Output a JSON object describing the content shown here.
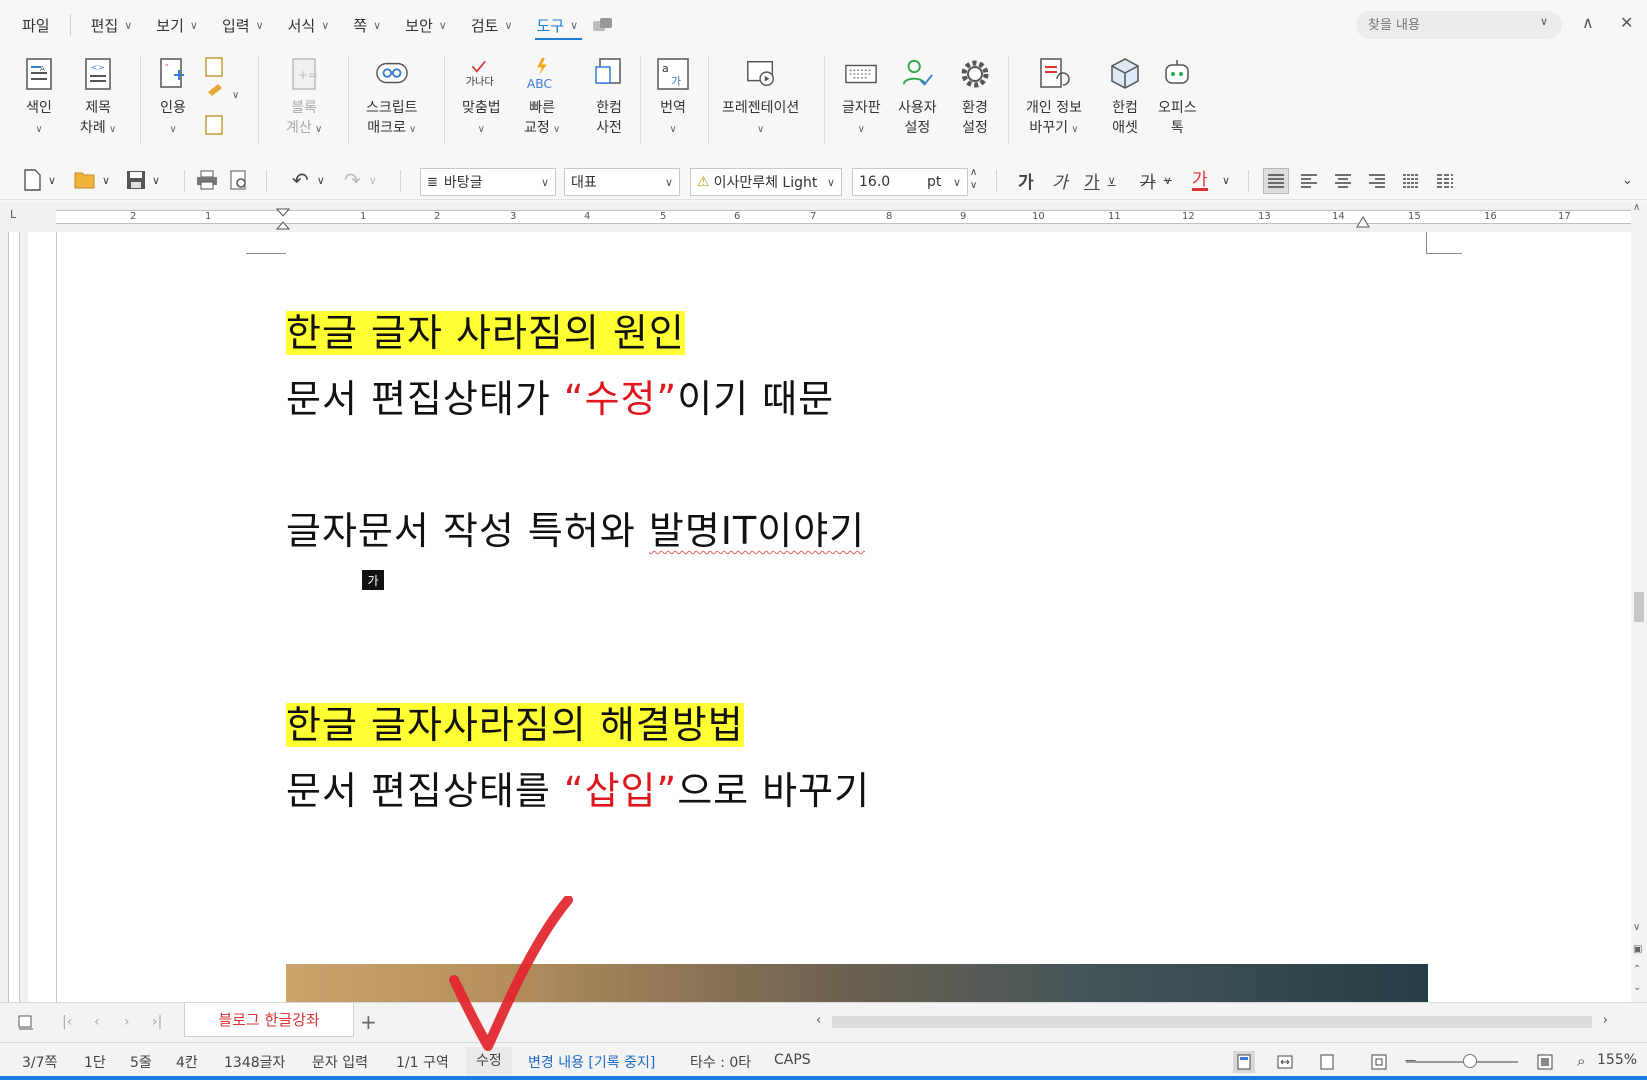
{
  "menu": {
    "items": [
      "파일",
      "편집",
      "보기",
      "입력",
      "서식",
      "쪽",
      "보안",
      "검토",
      "도구"
    ],
    "active": "도구",
    "search_placeholder": "찾을 내용"
  },
  "ribbon": {
    "index": "색인",
    "toc_1": "제목",
    "toc_2": "차례",
    "citation": "인용",
    "block_calc_1": "블록",
    "block_calc_2": "계산",
    "script_1": "스크립트",
    "script_2": "매크로",
    "spell_icon_text": "가나다",
    "spell": "맞춤법",
    "quick_fix_icon_text": "ABC",
    "quick_fix_1": "빠른",
    "quick_fix_2": "교정",
    "dict_1": "한컴",
    "dict_2": "사전",
    "translate": "번역",
    "presentation": "프레젠테이션",
    "keyboard": "글자판",
    "user_setting_1": "사용자",
    "user_setting_2": "설정",
    "env_setting_1": "환경",
    "env_setting_2": "설정",
    "privacy_1": "개인 정보",
    "privacy_2": "바꾸기",
    "asset_1": "한컴",
    "asset_2": "애셋",
    "office_talk_1": "오피스",
    "office_talk_2": "톡"
  },
  "toolbar": {
    "style": "바탕글",
    "lang": "대표",
    "font": "이사만루체 Light",
    "size": "16.0",
    "unit": "pt",
    "char_buttons": [
      "가",
      "가",
      "가",
      "가",
      "가"
    ]
  },
  "ruler": {
    "ticks": [
      "2",
      "1",
      "1",
      "2",
      "3",
      "4",
      "5",
      "6",
      "7",
      "8",
      "9",
      "10",
      "11",
      "12",
      "13",
      "14",
      "15",
      "16",
      "17"
    ]
  },
  "document": {
    "line1": "한글 글자 사라짐의 원인",
    "line2_a": "문서 편집상태가 ",
    "line2_b": "“수정”",
    "line2_c": "이기 때문",
    "line3_a": "글자문서 작성 특허와 ",
    "line3_b": "발명IT이야기",
    "ime_char": "가",
    "line4": "한글 글자사라짐의 해결방법",
    "line5_a": "문서 편집상태를 ",
    "line5_b": "“삽입”",
    "line5_c": "으로 바꾸기"
  },
  "tabs": {
    "doc_tab": "블로그 한글강좌",
    "add": "+"
  },
  "status": {
    "page": "3/7쪽",
    "column": "1단",
    "line": "5줄",
    "cell": "4칸",
    "chars": "1348글자",
    "input_mode": "문자 입력",
    "section": "1/1 구역",
    "edit_mode": "수정",
    "track_changes": "변경 내용 [기록 중지]",
    "typing": "타수 : 0타",
    "caps": "CAPS",
    "zoom": "155%"
  },
  "colors": {
    "accent": "#1c7ed6",
    "highlight": "#ffff33",
    "emphasis_red": "#e0161e",
    "annotation_red": "#e3242b"
  }
}
